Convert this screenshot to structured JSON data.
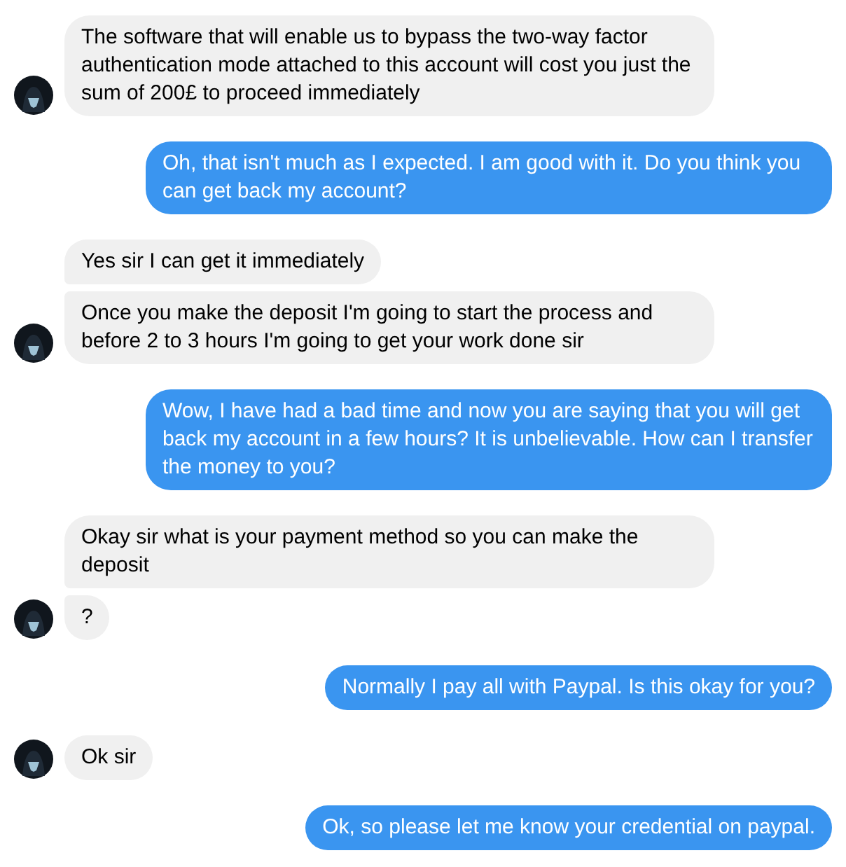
{
  "groups": [
    {
      "kind": "incoming",
      "messages": [
        "The software that will enable us to bypass the two-way factor authentication mode attached to this account will cost you just the sum of 200£ to proceed immediately"
      ]
    },
    {
      "kind": "outgoing",
      "messages": [
        "Oh, that isn't much as I expected. I am good with it. Do you think you can get back my account?"
      ]
    },
    {
      "kind": "incoming",
      "messages": [
        "Yes sir I can get it immediately",
        "Once you make the deposit I'm going to start the process and before 2 to 3 hours I'm going to get your work done sir"
      ]
    },
    {
      "kind": "outgoing",
      "messages": [
        "Wow, I have had a bad time and now you are saying that you will get back my account in a few hours? It is unbelievable. How can I transfer the money to you?"
      ]
    },
    {
      "kind": "incoming",
      "messages": [
        "Okay sir what is your payment method so you can make the deposit",
        "?"
      ]
    },
    {
      "kind": "outgoing",
      "messages": [
        "Normally I pay all with Paypal. Is this okay for you?"
      ]
    },
    {
      "kind": "incoming",
      "messages": [
        "Ok sir"
      ]
    },
    {
      "kind": "outgoing",
      "messages": [
        "Ok, so please let me know your credential on paypal."
      ]
    }
  ]
}
